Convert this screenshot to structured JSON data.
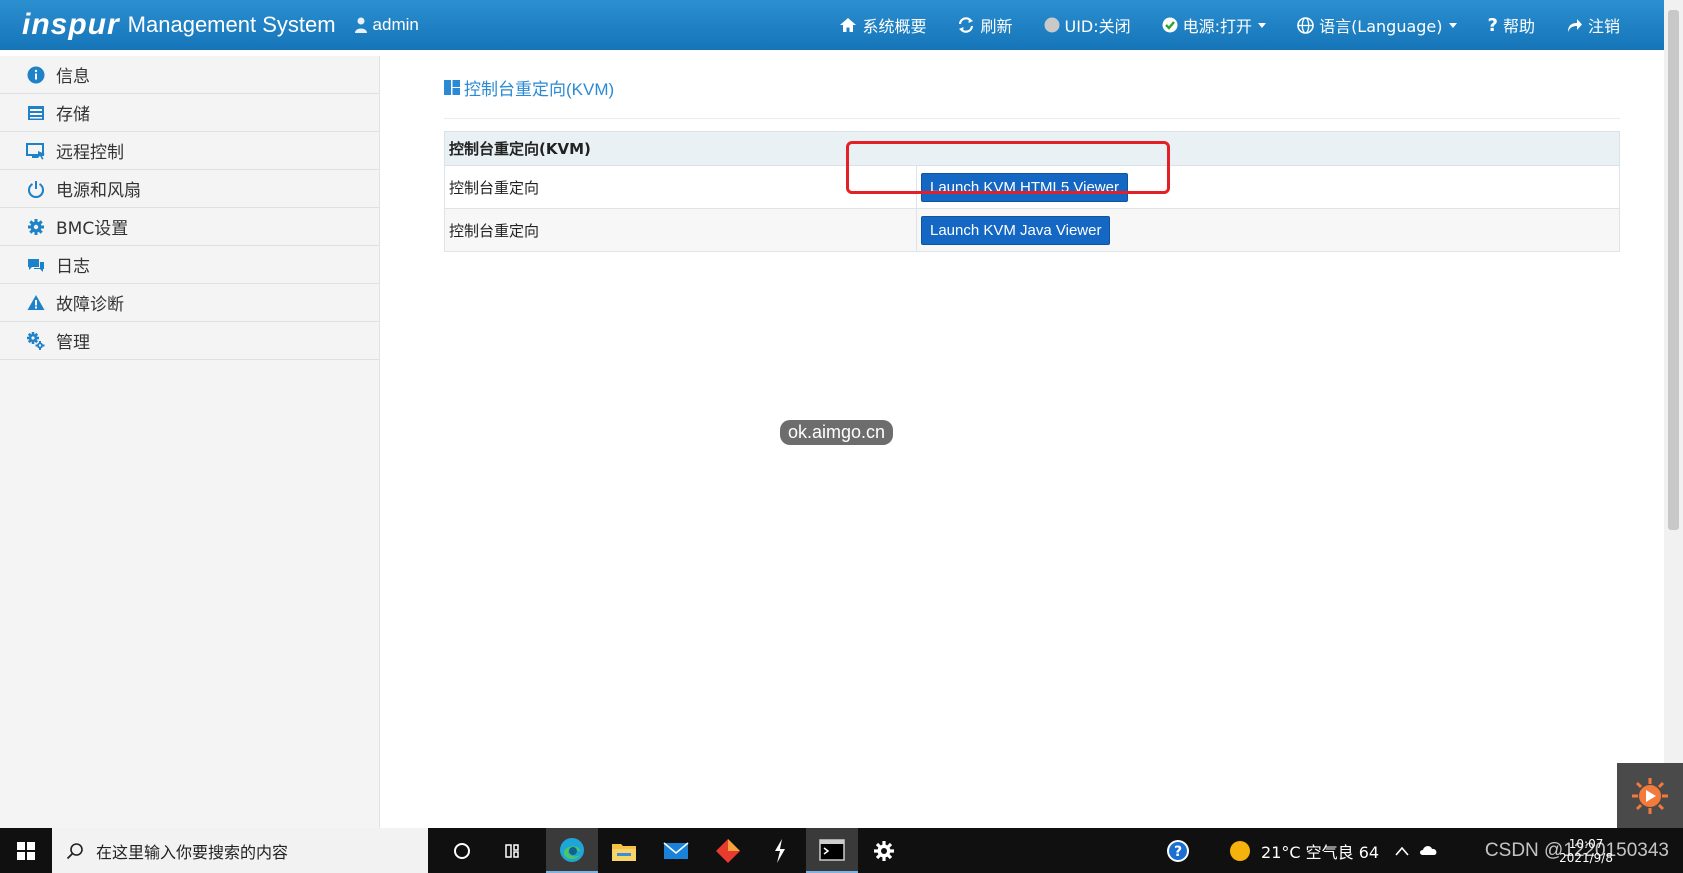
{
  "header": {
    "logo": "inspur",
    "title": "Management System",
    "user": "admin",
    "nav": [
      {
        "id": "overview",
        "label": "系统概要",
        "icon": "home-icon"
      },
      {
        "id": "refresh",
        "label": "刷新",
        "icon": "refresh-icon"
      },
      {
        "id": "uid",
        "label": "UID:关闭",
        "icon": "uid-indicator-icon"
      },
      {
        "id": "power",
        "label": "电源:打开",
        "icon": "power-check-icon"
      },
      {
        "id": "language",
        "label": "语言(Language)",
        "icon": "globe-icon"
      },
      {
        "id": "help",
        "label": "帮助",
        "icon": "help-icon"
      },
      {
        "id": "logout",
        "label": "注销",
        "icon": "logout-icon"
      }
    ]
  },
  "sidebar": {
    "items": [
      {
        "label": "信息",
        "icon": "info-icon"
      },
      {
        "label": "存储",
        "icon": "storage-icon"
      },
      {
        "label": "远程控制",
        "icon": "remote-control-icon"
      },
      {
        "label": "电源和风扇",
        "icon": "power-icon"
      },
      {
        "label": "BMC设置",
        "icon": "settings-icon"
      },
      {
        "label": "日志",
        "icon": "log-icon"
      },
      {
        "label": "故障诊断",
        "icon": "warning-icon"
      },
      {
        "label": "管理",
        "icon": "gears-icon"
      }
    ]
  },
  "main": {
    "title": "控制台重定向(KVM)",
    "table": {
      "header": "控制台重定向(KVM)",
      "rows": [
        {
          "label": "控制台重定向",
          "button": "Launch KVM HTML5 Viewer"
        },
        {
          "label": "控制台重定向",
          "button": "Launch KVM Java Viewer"
        }
      ]
    }
  },
  "watermark": "ok.aimgo.cn",
  "taskbar": {
    "search_placeholder": "在这里输入你要搜索的内容",
    "weather": "21°C 空气良 64",
    "time": "10:07",
    "date": "2021/9/8",
    "overlay": "CSDN @1220150343"
  },
  "colors": {
    "header": "#1f80c4",
    "accent": "#2a8ad4",
    "button": "#1468c4",
    "highlight": "#e51f26"
  }
}
